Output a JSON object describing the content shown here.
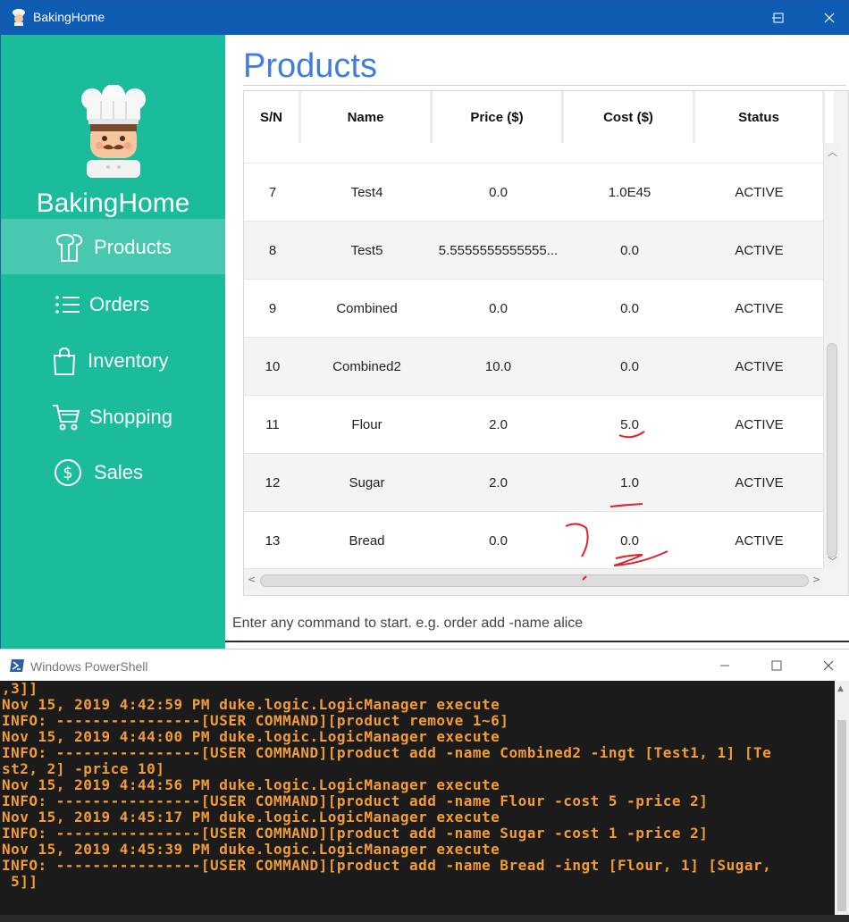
{
  "app": {
    "window_title": "BakingHome",
    "brand": "BakingHome",
    "nav": [
      {
        "label": "Products",
        "icon": "bread-icon",
        "active": true
      },
      {
        "label": "Orders",
        "icon": "list-icon",
        "active": false
      },
      {
        "label": "Inventory",
        "icon": "shopping-bag-icon",
        "active": false
      },
      {
        "label": "Shopping",
        "icon": "shopping-cart-icon",
        "active": false
      },
      {
        "label": "Sales",
        "icon": "dollar-icon",
        "active": false
      }
    ],
    "page_title": "Products",
    "table": {
      "columns": [
        "S/N",
        "Name",
        "Price ($)",
        "Cost ($)",
        "Status"
      ],
      "rows": [
        {
          "sn": "7",
          "name": "Test4",
          "price": "0.0",
          "cost": "1.0E45",
          "status": "ACTIVE"
        },
        {
          "sn": "8",
          "name": "Test5",
          "price": "5.5555555555555...",
          "cost": "0.0",
          "status": "ACTIVE"
        },
        {
          "sn": "9",
          "name": "Combined",
          "price": "0.0",
          "cost": "0.0",
          "status": "ACTIVE"
        },
        {
          "sn": "10",
          "name": "Combined2",
          "price": "10.0",
          "cost": "0.0",
          "status": "ACTIVE"
        },
        {
          "sn": "11",
          "name": "Flour",
          "price": "2.0",
          "cost": "5.0",
          "status": "ACTIVE"
        },
        {
          "sn": "12",
          "name": "Sugar",
          "price": "2.0",
          "cost": "1.0",
          "status": "ACTIVE"
        },
        {
          "sn": "13",
          "name": "Bread",
          "price": "0.0",
          "cost": "0.0",
          "status": "ACTIVE"
        }
      ]
    },
    "command_placeholder": "Enter any command to start. e.g. order add -name alice",
    "colors": {
      "sidebar": "#1abc9c",
      "sidebar_active": "#48c8ae",
      "title_blue": "#3f7fd8",
      "titlebar": "#0f5cb5",
      "annotation_red": "#e0202a"
    }
  },
  "powershell": {
    "window_title": "Windows PowerShell",
    "lines": [
      ",3]]",
      "Nov 15, 2019 4:42:59 PM duke.logic.LogicManager execute",
      "INFO: ----------------[USER COMMAND][product remove 1~6]",
      "Nov 15, 2019 4:44:00 PM duke.logic.LogicManager execute",
      "INFO: ----------------[USER COMMAND][product add -name Combined2 -ingt [Test1, 1] [Te",
      "st2, 2] -price 10]",
      "Nov 15, 2019 4:44:56 PM duke.logic.LogicManager execute",
      "INFO: ----------------[USER COMMAND][product add -name Flour -cost 5 -price 2]",
      "Nov 15, 2019 4:45:17 PM duke.logic.LogicManager execute",
      "INFO: ----------------[USER COMMAND][product add -name Sugar -cost 1 -price 2]",
      "Nov 15, 2019 4:45:39 PM duke.logic.LogicManager execute",
      "INFO: ----------------[USER COMMAND][product add -name Bread -ingt [Flour, 1] [Sugar,",
      " 5]]"
    ],
    "text_color": "#f39c37"
  }
}
